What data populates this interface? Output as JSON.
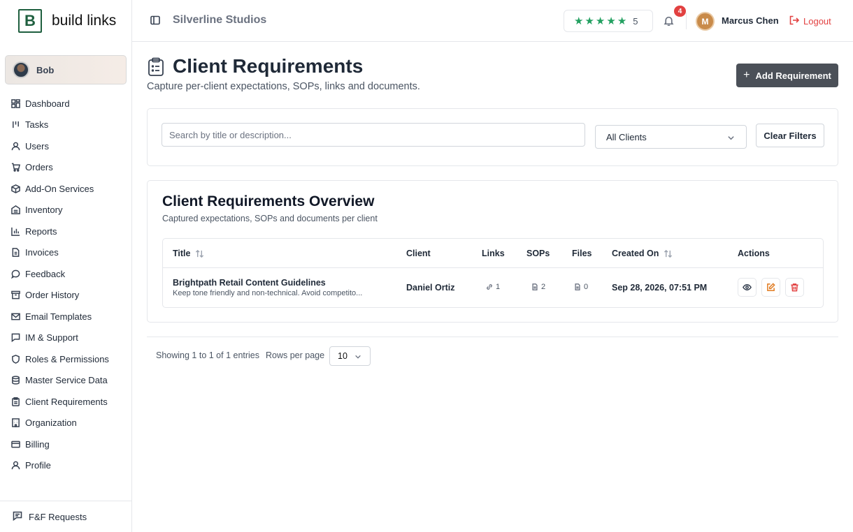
{
  "brand": {
    "letter": "B",
    "name": "build links"
  },
  "user_card": {
    "name": "Bob"
  },
  "sidebar": {
    "items": [
      {
        "label": "Dashboard",
        "icon": "dashboard-icon"
      },
      {
        "label": "Tasks",
        "icon": "tasks-icon"
      },
      {
        "label": "Users",
        "icon": "user-icon"
      },
      {
        "label": "Orders",
        "icon": "cart-icon"
      },
      {
        "label": "Add-On Services",
        "icon": "package-icon"
      },
      {
        "label": "Inventory",
        "icon": "inventory-icon"
      },
      {
        "label": "Reports",
        "icon": "bar-chart-icon"
      },
      {
        "label": "Invoices",
        "icon": "invoice-icon"
      },
      {
        "label": "Feedback",
        "icon": "chat-bubble-icon"
      },
      {
        "label": "Order History",
        "icon": "archive-icon"
      },
      {
        "label": "Email Templates",
        "icon": "mail-icon"
      },
      {
        "label": "IM & Support",
        "icon": "message-square-icon"
      },
      {
        "label": "Roles & Permissions",
        "icon": "shield-icon"
      },
      {
        "label": "Master Service Data",
        "icon": "database-icon"
      },
      {
        "label": "Client Requirements",
        "icon": "clipboard-icon"
      },
      {
        "label": "Organization",
        "icon": "building-icon"
      },
      {
        "label": "Billing",
        "icon": "credit-card-icon"
      },
      {
        "label": "Profile",
        "icon": "user-icon"
      }
    ],
    "footer": {
      "label": "F&F Requests",
      "icon": "message-lines-icon"
    }
  },
  "header": {
    "org_name": "Silverline Studios",
    "rating_value": "5",
    "rating_stars": 5,
    "notification_count": "4",
    "avatar_initial": "M",
    "user_name": "Marcus Chen",
    "logout_label": "Logout"
  },
  "page": {
    "title": "Client Requirements",
    "subtitle": "Capture per-client expectations, SOPs, links and documents.",
    "add_button": "Add Requirement"
  },
  "filters": {
    "search_placeholder": "Search by title or description...",
    "client_select": "All Clients",
    "clear_button": "Clear Filters"
  },
  "overview": {
    "title": "Client Requirements Overview",
    "subtitle": "Captured expectations, SOPs and documents per client",
    "columns": [
      "Title",
      "Client",
      "Links",
      "SOPs",
      "Files",
      "Created On",
      "Actions"
    ],
    "rows": [
      {
        "title": "Brightpath Retail Content Guidelines",
        "description": "Keep tone friendly and non-technical. Avoid competito...",
        "client": "Daniel Ortiz",
        "links": "1",
        "sops": "2",
        "files": "0",
        "created_on": "Sep 28, 2026, 07:51 PM"
      }
    ]
  },
  "pagination": {
    "summary": "Showing 1 to 1 of 1 entries",
    "rows_label": "Rows per page",
    "rows_value": "10"
  },
  "colors": {
    "brand_green": "#1f5f3f",
    "star_green": "#22a060",
    "danger_red": "#e24141",
    "edit_orange": "#e07a1f",
    "primary_button": "#4b5058"
  }
}
